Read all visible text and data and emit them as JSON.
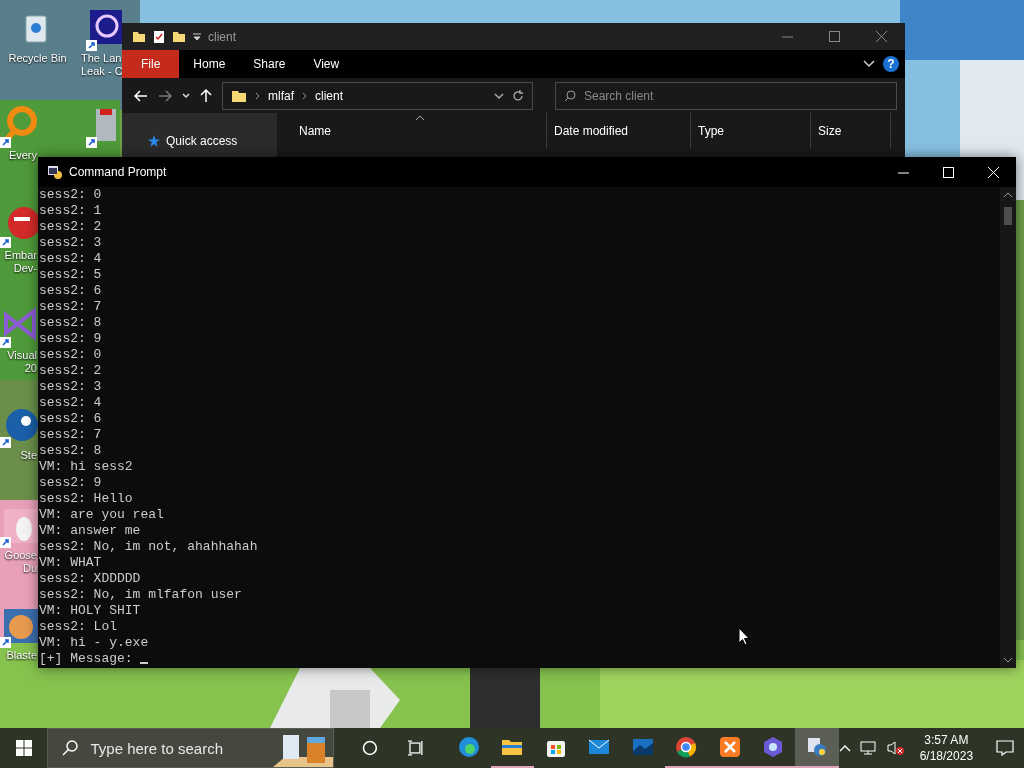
{
  "desktop_icons": [
    {
      "kind": "bin",
      "lines": [
        "Recycle Bin"
      ]
    },
    {
      "kind": "purple",
      "lines": [
        "The Lan",
        "Leak - C"
      ]
    },
    {
      "kind": "magnifier",
      "lines": [
        "Every"
      ]
    },
    {
      "kind": "tool"
    },
    {
      "kind": "red",
      "lines": [
        "Embar",
        "Dev-"
      ]
    },
    {
      "kind": "vs",
      "lines": [
        "Visual",
        "20"
      ]
    },
    {
      "kind": "steam",
      "lines": [
        "Ste"
      ]
    },
    {
      "kind": "goose",
      "lines": [
        "Goose",
        "Du"
      ]
    },
    {
      "kind": "avatar",
      "lines": [
        "Blaste"
      ]
    }
  ],
  "explorer": {
    "title": "client",
    "ribbon_tabs": [
      {
        "label": "File",
        "kind": "file"
      },
      {
        "label": "Home",
        "kind": "tab"
      },
      {
        "label": "Share",
        "kind": "tab"
      },
      {
        "label": "View",
        "kind": "tab"
      }
    ],
    "help": "?",
    "path": [
      "mlfaf",
      "client"
    ],
    "search": {
      "placeholder": "Search client"
    },
    "nav_item": "Quick access",
    "columns": [
      "Name",
      "Date modified",
      "Type",
      "Size"
    ]
  },
  "cmd": {
    "title": "Command Prompt",
    "lines": [
      "sess2: 0",
      "sess2: 1",
      "sess2: 2",
      "sess2: 3",
      "sess2: 4",
      "sess2: 5",
      "sess2: 6",
      "sess2: 7",
      "sess2: 8",
      "sess2: 9",
      "sess2: 0",
      "sess2: 2",
      "sess2: 3",
      "sess2: 4",
      "sess2: 6",
      "sess2: 7",
      "sess2: 8",
      "VM: hi sess2",
      "sess2: 9",
      "sess2: Hello",
      "VM: are you real",
      "VM: answer me",
      "sess2: No, im not, ahahhahah",
      "VM: WHAT",
      "sess2: XDDDDD",
      "sess2: No, im mlfafon user",
      "VM: HOLY SHIT",
      "sess2: Lol",
      "VM: hi - y.exe"
    ],
    "prompt": "[+] Message: "
  },
  "taskbar": {
    "search": {
      "placeholder": "Type here to search"
    },
    "apps": [
      {
        "kind": "edge",
        "running": false,
        "selected": false
      },
      {
        "kind": "folder",
        "running": true,
        "selected": false
      },
      {
        "kind": "store",
        "running": false,
        "selected": false
      },
      {
        "kind": "mail",
        "running": false,
        "selected": false
      },
      {
        "kind": "film",
        "running": false,
        "selected": false
      },
      {
        "kind": "chrome",
        "running": true,
        "selected": false
      },
      {
        "kind": "xampp",
        "running": true,
        "selected": false
      },
      {
        "kind": "swirl",
        "running": true,
        "selected": false
      },
      {
        "kind": "python",
        "running": true,
        "selected": true
      }
    ],
    "time": "3:57 AM",
    "date": "6/18/2023"
  }
}
